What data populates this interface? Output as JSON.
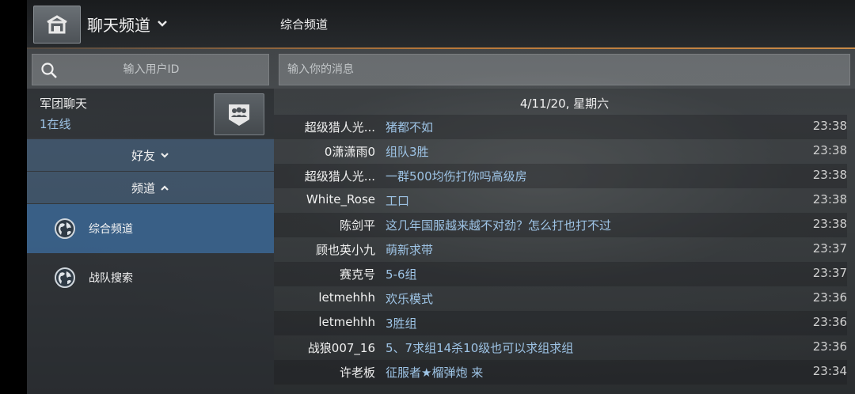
{
  "header": {
    "channel_dropdown_label": "聊天频道",
    "current_channel": "综合频道"
  },
  "search": {
    "user_placeholder": "输入用户ID"
  },
  "composer": {
    "placeholder": "输入你的消息"
  },
  "legion": {
    "name": "军团聊天",
    "online": "1在线"
  },
  "sidebar": {
    "friends_label": "好友",
    "channels_label": "频道",
    "items": [
      {
        "label": "综合频道",
        "active": true
      },
      {
        "label": "战队搜索",
        "active": false
      }
    ]
  },
  "chat": {
    "date": "4/11/20, 星期六",
    "messages": [
      {
        "sender": "超级猎人光...",
        "text": "猪都不如",
        "time": "23:38"
      },
      {
        "sender": "0潇潇雨0",
        "text": "组队3胜",
        "time": "23:38"
      },
      {
        "sender": "超级猎人光...",
        "text": "一群500均伤打你吗高级房",
        "time": "23:38"
      },
      {
        "sender": "White_Rose",
        "text": "工口",
        "time": "23:38"
      },
      {
        "sender": "陈剑平",
        "text": "这几年国服越来越不对劲？怎么打也打不过",
        "time": "23:38"
      },
      {
        "sender": "顾也英小九",
        "text": "萌新求带",
        "time": "23:37"
      },
      {
        "sender": "赛克号",
        "text": "5-6组",
        "time": "23:37"
      },
      {
        "sender": "letmehhh",
        "text": "欢乐模式",
        "time": "23:36"
      },
      {
        "sender": "letmehhh",
        "text": "3胜组",
        "time": "23:36"
      },
      {
        "sender": "战狼007_16",
        "text": "5、7求组14杀10级也可以求组求组",
        "time": "23:36"
      },
      {
        "sender": "许老板",
        "text": "征服者★榴弹炮 来",
        "time": "23:34"
      }
    ]
  },
  "colors": {
    "accent_line": "#b8773a",
    "message_text": "#9ec4e6",
    "active_item": "#3c6ea0"
  }
}
